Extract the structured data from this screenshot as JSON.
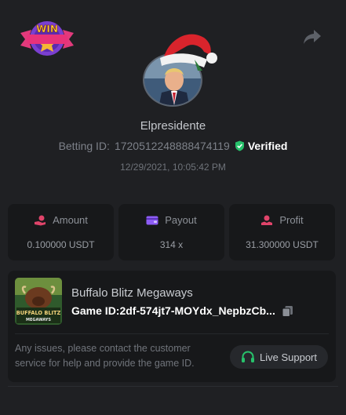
{
  "badge": {
    "text": "WIN"
  },
  "user": {
    "name": "Elpresidente",
    "betting_id_label": "Betting ID:",
    "betting_id": "1720512248888474119",
    "verified_label": "Verified",
    "timestamp": "12/29/2021, 10:05:42 PM"
  },
  "stats": [
    {
      "label": "Amount",
      "value": "0.100000 USDT",
      "icon": "money-hand-icon",
      "color": "#e0446a"
    },
    {
      "label": "Payout",
      "value": "314 x",
      "icon": "wallet-icon",
      "color": "#8d5cf6"
    },
    {
      "label": "Profit",
      "value": "31.300000 USDT",
      "icon": "profit-hand-icon",
      "color": "#e0446a"
    }
  ],
  "game": {
    "title": "Buffalo Blitz Megaways",
    "id_label": "Game ID:",
    "id": "2df-574jt7-MOYdx_NepbzCb...",
    "thumb_text_1": "BUFFALO BLITZ",
    "thumb_text_2": "MEGAWAYS"
  },
  "support": {
    "notice": "Any issues, please contact the customer service for help and provide the game ID.",
    "button_label": "Live Support"
  },
  "colors": {
    "accent_green": "#27c26b",
    "background": "#1f2023",
    "card": "#17181a"
  }
}
